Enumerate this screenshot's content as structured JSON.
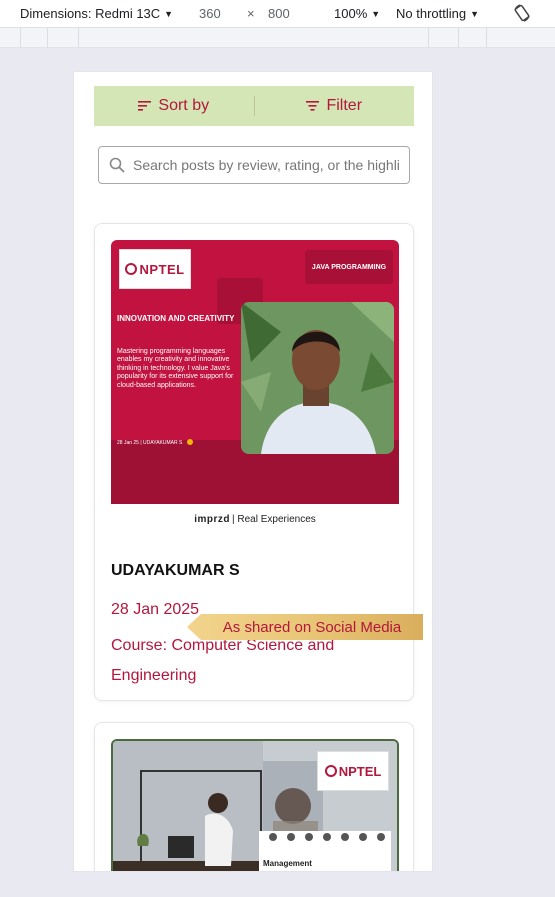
{
  "devtools": {
    "device_label": "Dimensions: Redmi 13C",
    "width": "360",
    "times": "×",
    "height": "800",
    "zoom": "100%",
    "throttle": "No throttling"
  },
  "toolbar": {
    "sort_label": "Sort by",
    "filter_label": "Filter"
  },
  "search": {
    "placeholder": "Search posts by review, rating, or the highli"
  },
  "posts": [
    {
      "logo_text": "NPTEL",
      "topic": "JAVA PROGRAMMING",
      "headline": "INNOVATION AND CREATIVITY",
      "quote": "Mastering programming languages enables my creativity and innovative thinking in technology. I value Java's popularity for its extensive support for cloud-based applications.",
      "meta": "28 Jan 25  |  UDAYAKUMAR S",
      "brand_name": "imprzd",
      "brand_tag": "| Real Experiences",
      "name": "UDAYAKUMAR S",
      "date": "28 Jan 2025",
      "course": "Course: Computer Science and Engineering"
    },
    {
      "logo_text": "NPTEL",
      "panel_title": "Management"
    }
  ],
  "ribbon": {
    "text": "As shared on Social Media"
  },
  "colors": {
    "accent": "#b3173d",
    "sortbar_bg": "#d4e6b5",
    "ribbon_gold": "#e6c37a"
  }
}
